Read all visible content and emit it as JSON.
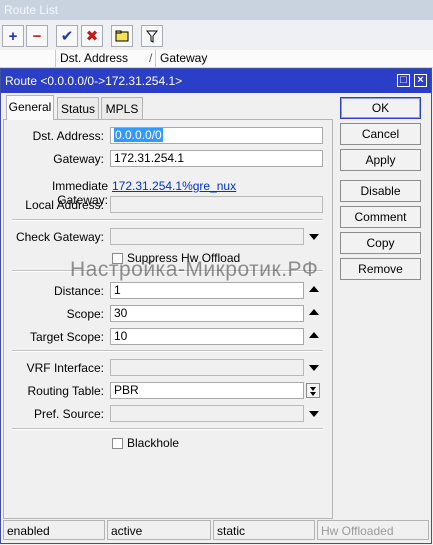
{
  "background_window": {
    "title": "Route List",
    "columns": [
      "Dst. Address",
      "Gateway"
    ],
    "sort_marker": "/"
  },
  "dialog": {
    "title": "Route <0.0.0.0/0->172.31.254.1>",
    "tabs": [
      "General",
      "Status",
      "MPLS"
    ],
    "fields": {
      "dst_address": {
        "label": "Dst. Address:",
        "value": "0.0.0.0/0"
      },
      "gateway": {
        "label": "Gateway:",
        "value": "172.31.254.1"
      },
      "immediate_gateway": {
        "label": "Immediate Gateway:",
        "value": "172.31.254.1%gre_nux"
      },
      "local_address": {
        "label": "Local Address:",
        "value": ""
      },
      "check_gateway": {
        "label": "Check Gateway:",
        "value": ""
      },
      "suppress_hw_offload": {
        "label": "Suppress Hw Offload",
        "checked": false
      },
      "distance": {
        "label": "Distance:",
        "value": "1"
      },
      "scope": {
        "label": "Scope:",
        "value": "30"
      },
      "target_scope": {
        "label": "Target Scope:",
        "value": "10"
      },
      "vrf_interface": {
        "label": "VRF Interface:",
        "value": ""
      },
      "routing_table": {
        "label": "Routing Table:",
        "value": "PBR"
      },
      "pref_source": {
        "label": "Pref. Source:",
        "value": ""
      },
      "blackhole": {
        "label": "Blackhole",
        "checked": false
      }
    },
    "buttons": [
      "OK",
      "Cancel",
      "Apply",
      "Disable",
      "Comment",
      "Copy",
      "Remove"
    ],
    "status_bar": [
      "enabled",
      "active",
      "static",
      "Hw Offloaded"
    ]
  },
  "watermark": "Настройка-Микротик.РФ",
  "colors": {
    "title_active": "#2a3ec8",
    "title_inactive": "#c9d3e0",
    "selection": "#3399ff",
    "link": "#0033cc"
  }
}
